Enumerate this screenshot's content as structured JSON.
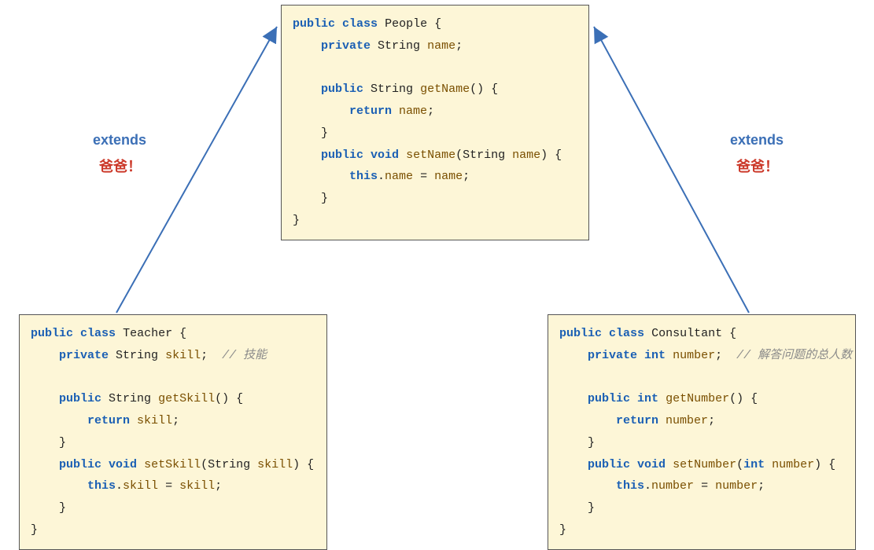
{
  "labels": {
    "extends_left": "extends",
    "baba_left": "爸爸！",
    "extends_right": "extends",
    "baba_right": "爸爸！"
  },
  "people": {
    "l1_kw1": "public",
    "l1_kw2": "class",
    "l1_name": "People",
    "l2_kw": "private",
    "l2_type": "String",
    "l2_field": "name",
    "l3_kw": "public",
    "l3_type": "String",
    "l3_method": "getName",
    "l4_kw": "return",
    "l4_ret": "name",
    "l5_kw1": "public",
    "l5_kw2": "void",
    "l5_method": "setName",
    "l5_ptype": "String",
    "l5_pname": "name",
    "l6_kw": "this",
    "l6_field": "name",
    "l6_rhs": "name"
  },
  "teacher": {
    "l1_kw1": "public",
    "l1_kw2": "class",
    "l1_name": "Teacher",
    "l2_kw": "private",
    "l2_type": "String",
    "l2_field": "skill",
    "l2_comment": "// 技能",
    "l3_kw": "public",
    "l3_type": "String",
    "l3_method": "getSkill",
    "l4_kw": "return",
    "l4_ret": "skill",
    "l5_kw1": "public",
    "l5_kw2": "void",
    "l5_method": "setSkill",
    "l5_ptype": "String",
    "l5_pname": "skill",
    "l6_kw": "this",
    "l6_field": "skill",
    "l6_rhs": "skill"
  },
  "consultant": {
    "l1_kw1": "public",
    "l1_kw2": "class",
    "l1_name": "Consultant",
    "l2_kw": "private",
    "l2_type": "int",
    "l2_field": "number",
    "l2_comment": "// 解答问题的总人数",
    "l3_kw": "public",
    "l3_type": "int",
    "l3_method": "getNumber",
    "l4_kw": "return",
    "l4_ret": "number",
    "l5_kw1": "public",
    "l5_kw2": "void",
    "l5_method": "setNumber",
    "l5_ptype": "int",
    "l5_pname": "number",
    "l6_kw": "this",
    "l6_field": "number",
    "l6_rhs": "number"
  }
}
